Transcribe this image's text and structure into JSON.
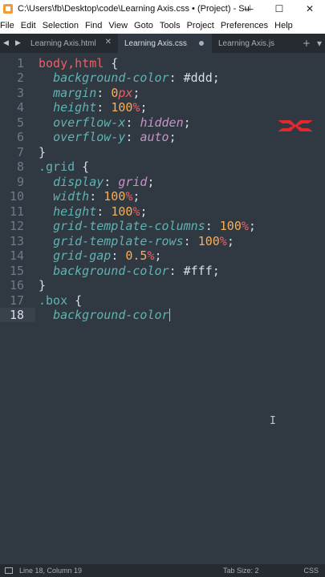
{
  "window": {
    "title": "C:\\Users\\fb\\Desktop\\code\\Learning Axis.css • (Project) - Sub...",
    "minimize": "—",
    "maximize": "☐",
    "close": "✕"
  },
  "menu": [
    "File",
    "Edit",
    "Selection",
    "Find",
    "View",
    "Goto",
    "Tools",
    "Project",
    "Preferences",
    "Help"
  ],
  "tabs": [
    {
      "label": "Learning Axis.html",
      "state": "close"
    },
    {
      "label": "Learning Axis.css",
      "state": "modified"
    },
    {
      "label": "Learning Axis.js",
      "state": "close"
    }
  ],
  "tab_tools": {
    "add": "+",
    "more": "▾"
  },
  "gutter": [
    "1",
    "2",
    "3",
    "4",
    "5",
    "6",
    "7",
    "8",
    "9",
    "10",
    "11",
    "12",
    "13",
    "14",
    "15",
    "16",
    "17",
    "18"
  ],
  "code": {
    "l1": {
      "sel": "body,html",
      "brace": " {"
    },
    "l2": {
      "prop": "background-color",
      "colon": ": ",
      "val": "#ddd",
      "semi": ";"
    },
    "l3": {
      "prop": "margin",
      "colon": ": ",
      "num": "0",
      "unit": "px",
      "semi": ";"
    },
    "l4": {
      "prop": "height",
      "colon": ": ",
      "num": "100",
      "unit": "%",
      "semi": ";"
    },
    "l5": {
      "prop": "overflow-x",
      "colon": ": ",
      "kw": "hidden",
      "semi": ";"
    },
    "l6": {
      "prop": "overflow-y",
      "colon": ": ",
      "kw": "auto",
      "semi": ";"
    },
    "l7": {
      "brace": "}"
    },
    "l8": {
      "sel": ".grid",
      "brace": " {"
    },
    "l9": {
      "prop": "display",
      "colon": ": ",
      "kw": "grid",
      "semi": ";"
    },
    "l10": {
      "prop": "width",
      "colon": ": ",
      "num": "100",
      "unit": "%",
      "semi": ";"
    },
    "l11": {
      "prop": "height",
      "colon": ": ",
      "num": "100",
      "unit": "%",
      "semi": ";"
    },
    "l12": {
      "prop": "grid-template-columns",
      "colon": ": ",
      "num": "100",
      "unit": "%",
      "semi": ";"
    },
    "l13": {
      "prop": "grid-template-rows",
      "colon": ": ",
      "num": "100",
      "unit": "%",
      "semi": ";"
    },
    "l14": {
      "prop": "grid-gap",
      "colon": ": ",
      "num": "0.5",
      "unit": "%",
      "semi": ";"
    },
    "l15": {
      "prop": "background-color",
      "colon": ": ",
      "val": "#fff",
      "semi": ";"
    },
    "l16": {
      "brace": "}"
    },
    "l17": {
      "sel": ".box",
      "brace": " {"
    },
    "l18": {
      "prop": "background-color"
    }
  },
  "status": {
    "position": "Line 18, Column 19",
    "tab_size": "Tab Size: 2",
    "syntax": "CSS"
  },
  "colors": {
    "editor_bg": "#303841",
    "selector": "#ec5f66",
    "property": "#5fb4b4",
    "number": "#f9ae58",
    "keyword": "#c695c6",
    "logo": "#e0282e"
  },
  "icons": {
    "logo": "learning-axis-logo-icon",
    "cursor": "text-cursor-icon"
  }
}
